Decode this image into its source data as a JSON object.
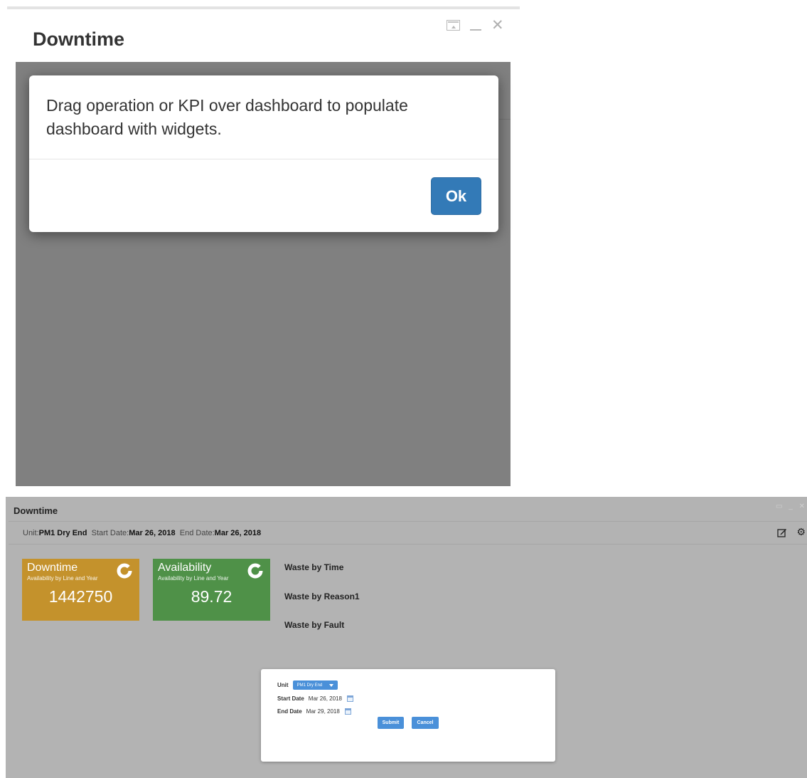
{
  "top_panel": {
    "title": "Downtime",
    "window_controls": [
      "restore",
      "minimize",
      "close"
    ],
    "modal": {
      "message": "Drag operation or KPI over dashboard to populate dashboard with widgets.",
      "ok_label": "Ok"
    }
  },
  "bottom_panel": {
    "title": "Downtime",
    "filter": {
      "unit_label": "Unit:",
      "unit_value": "PM1 Dry End",
      "start_label": "Start Date:",
      "start_value": "Mar 26, 2018",
      "end_label": "End Date:",
      "end_value": "Mar 26, 2018"
    },
    "tiles": [
      {
        "title": "Downtime",
        "subtitle": "Availability by Line and Year",
        "value": "1442750",
        "color": "#c4922c"
      },
      {
        "title": "Availability",
        "subtitle": "Availability by Line and Year",
        "value": "89.72",
        "color": "#4f9148"
      }
    ],
    "waste_items": [
      "Waste by Time",
      "Waste by Reason1",
      "Waste by Fault"
    ],
    "dialog": {
      "unit_label": "Unit",
      "unit_value": "PM1 Dry End",
      "start_label": "Start Date",
      "start_value": "Mar 26, 2018",
      "end_label": "End Date",
      "end_value": "Mar 29, 2018",
      "submit_label": "Submit",
      "cancel_label": "Cancel"
    }
  },
  "colors": {
    "primary": "#337ab7",
    "overlay_dark": "#808080",
    "overlay_light": "#b3b3b3"
  }
}
